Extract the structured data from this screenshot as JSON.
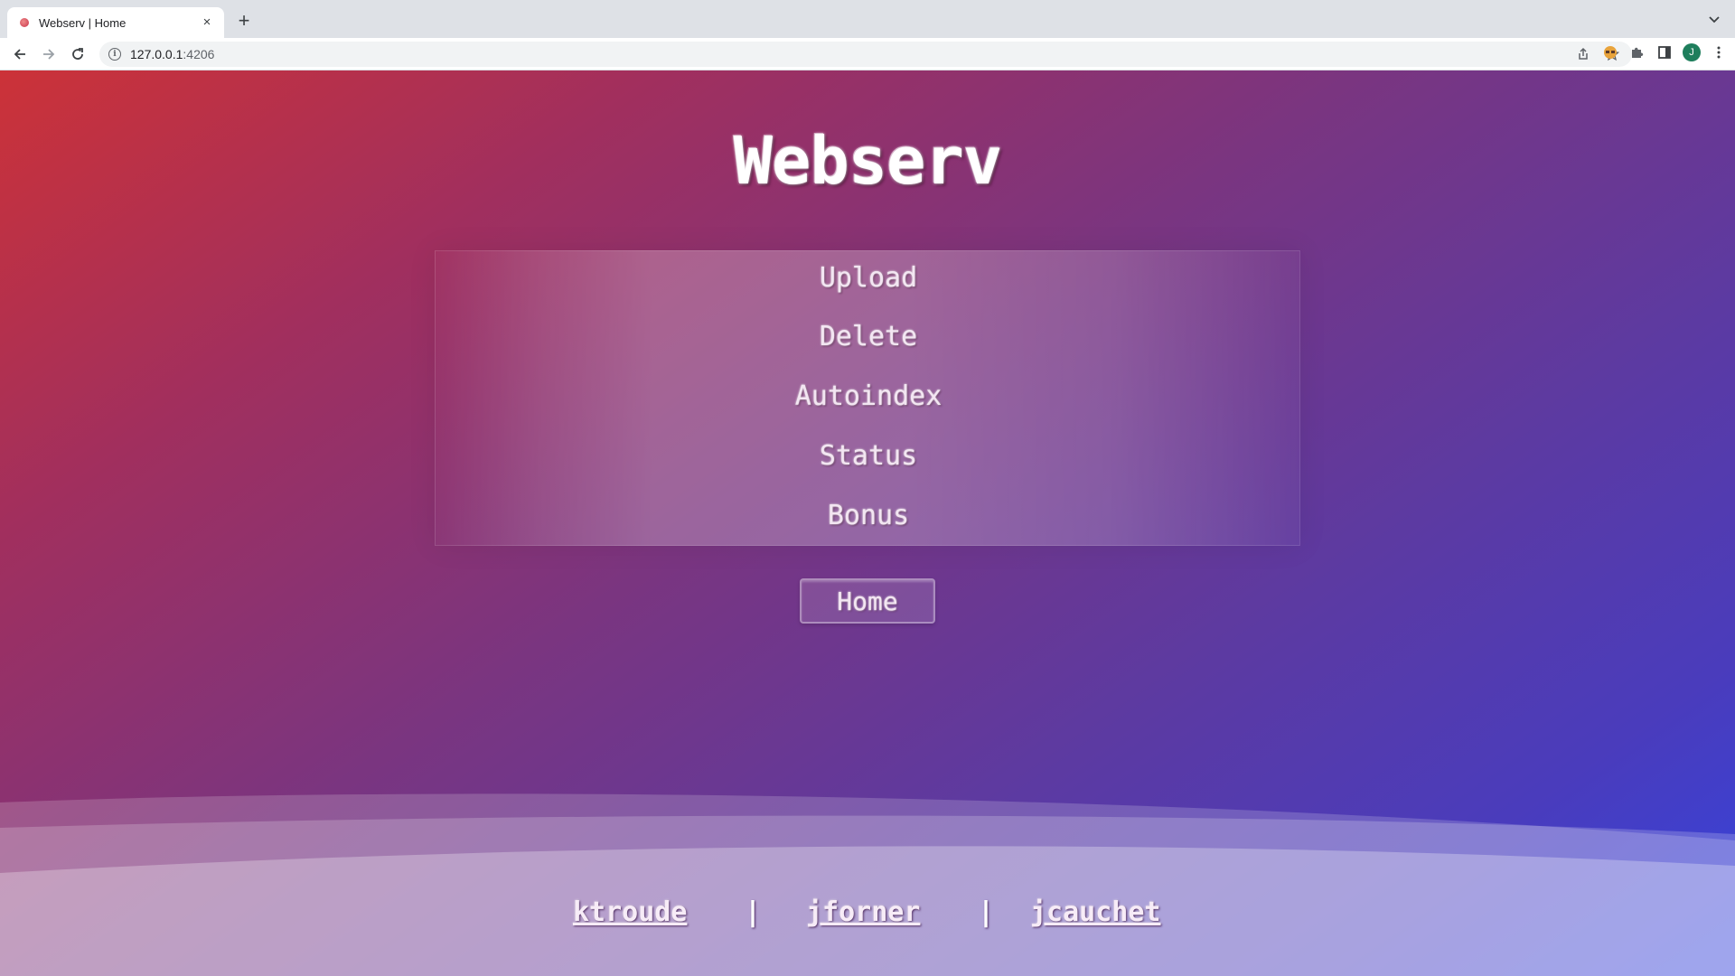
{
  "browser": {
    "tab": {
      "title": "Webserv | Home",
      "close_label": "×"
    },
    "new_tab_label": "+",
    "address_bar": {
      "host": "127.0.0.1",
      "port": ":4206"
    },
    "profile_initial": "J"
  },
  "page": {
    "title": "Webserv",
    "menu": [
      {
        "label": "Upload"
      },
      {
        "label": "Delete"
      },
      {
        "label": "Autoindex"
      },
      {
        "label": "Status"
      },
      {
        "label": "Bonus"
      }
    ],
    "home_button": "Home",
    "footer": {
      "authors": [
        "ktroude",
        "jforner",
        "jcauchet"
      ],
      "separator": "|"
    }
  },
  "colors": {
    "gradient_start": "#cc3238",
    "gradient_mid": "#7a3580",
    "gradient_end": "#3443de",
    "text_light": "#ffffff"
  },
  "icons": [
    "back-arrow-icon",
    "forward-arrow-icon",
    "reload-icon",
    "info-icon",
    "share-icon",
    "star-icon",
    "extension-face-icon",
    "puzzle-icon",
    "side-panel-icon",
    "kebab-menu-icon",
    "tab-search-chevron-icon"
  ]
}
